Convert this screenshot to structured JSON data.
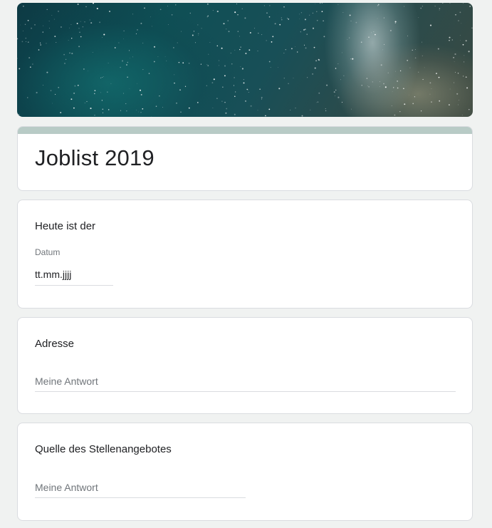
{
  "form": {
    "title": "Joblist 2019",
    "banner_icon": "starry-sky-header-image"
  },
  "questions": [
    {
      "title": "Heute ist der",
      "sublabel": "Datum",
      "value": "tt.mm.jjjj"
    },
    {
      "title": "Adresse",
      "placeholder": "Meine Antwort"
    },
    {
      "title": "Quelle des Stellenangebotes",
      "placeholder": "Meine Antwort"
    }
  ],
  "colors": {
    "page_background": "#f0f2f1",
    "accent_bar": "#b8cbc6",
    "card_border": "#dadce0"
  }
}
